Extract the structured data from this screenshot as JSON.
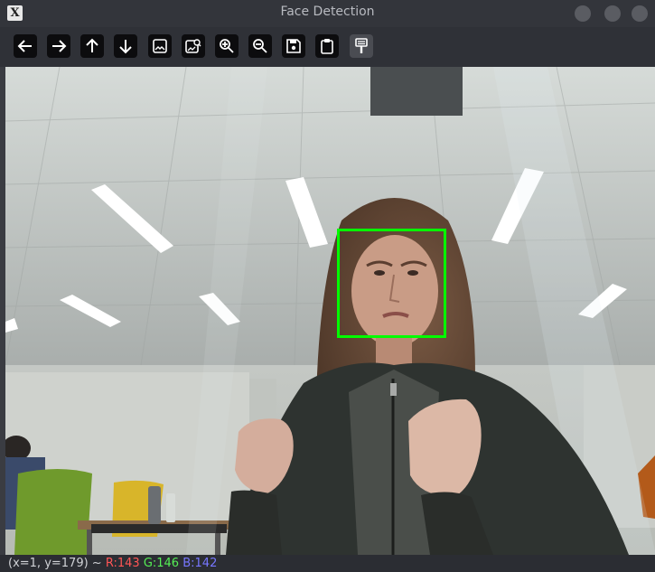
{
  "window": {
    "title": "Face Detection",
    "app_icon": "X"
  },
  "toolbar": {
    "buttons": [
      {
        "icon": "arrow-left-icon"
      },
      {
        "icon": "arrow-right-icon"
      },
      {
        "icon": "arrow-up-icon"
      },
      {
        "icon": "arrow-down-icon"
      },
      {
        "icon": "image-icon"
      },
      {
        "icon": "image-search-icon"
      },
      {
        "icon": "zoom-in-icon"
      },
      {
        "icon": "zoom-out-icon"
      },
      {
        "icon": "save-icon"
      },
      {
        "icon": "clipboard-icon"
      },
      {
        "icon": "properties-icon"
      }
    ]
  },
  "image": {
    "detection_box_color": "#00ff00"
  },
  "status": {
    "coords": "(x=1, y=179) ~",
    "r": "R:143",
    "g": "G:146",
    "b": "B:142"
  }
}
